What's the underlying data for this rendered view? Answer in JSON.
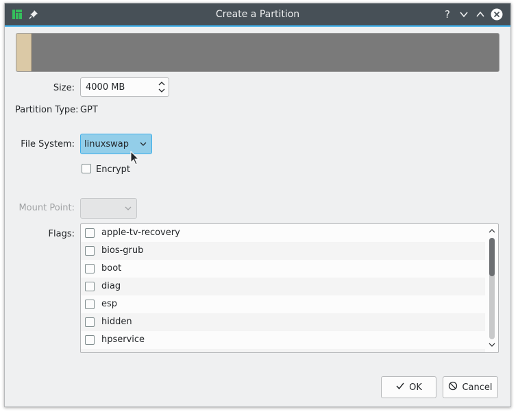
{
  "window": {
    "title": "Create a Partition"
  },
  "titlebar_icons": {
    "app": "manjaro-logo-icon",
    "pin": "pin-icon",
    "help": "?",
    "minimize": "chevron-down-icon",
    "maximize": "chevron-up-icon",
    "close": "close-icon"
  },
  "size": {
    "label": "Size:",
    "value": "4000 MB"
  },
  "partition_type": {
    "label": "Partition Type:",
    "value": "GPT"
  },
  "file_system": {
    "label": "File System:",
    "value": "linuxswap"
  },
  "encrypt": {
    "label": "Encrypt",
    "checked": false
  },
  "mount_point": {
    "label": "Mount Point:",
    "value": ""
  },
  "flags": {
    "label": "Flags:",
    "items": [
      "apple-tv-recovery",
      "bios-grub",
      "boot",
      "diag",
      "esp",
      "hidden",
      "hpservice"
    ]
  },
  "buttons": {
    "ok": "OK",
    "cancel": "Cancel"
  },
  "colors": {
    "accent": "#3daee9",
    "titlebar": "#475057",
    "partition_segment": "#dbc9a6",
    "free_space": "#7a7a7a"
  }
}
